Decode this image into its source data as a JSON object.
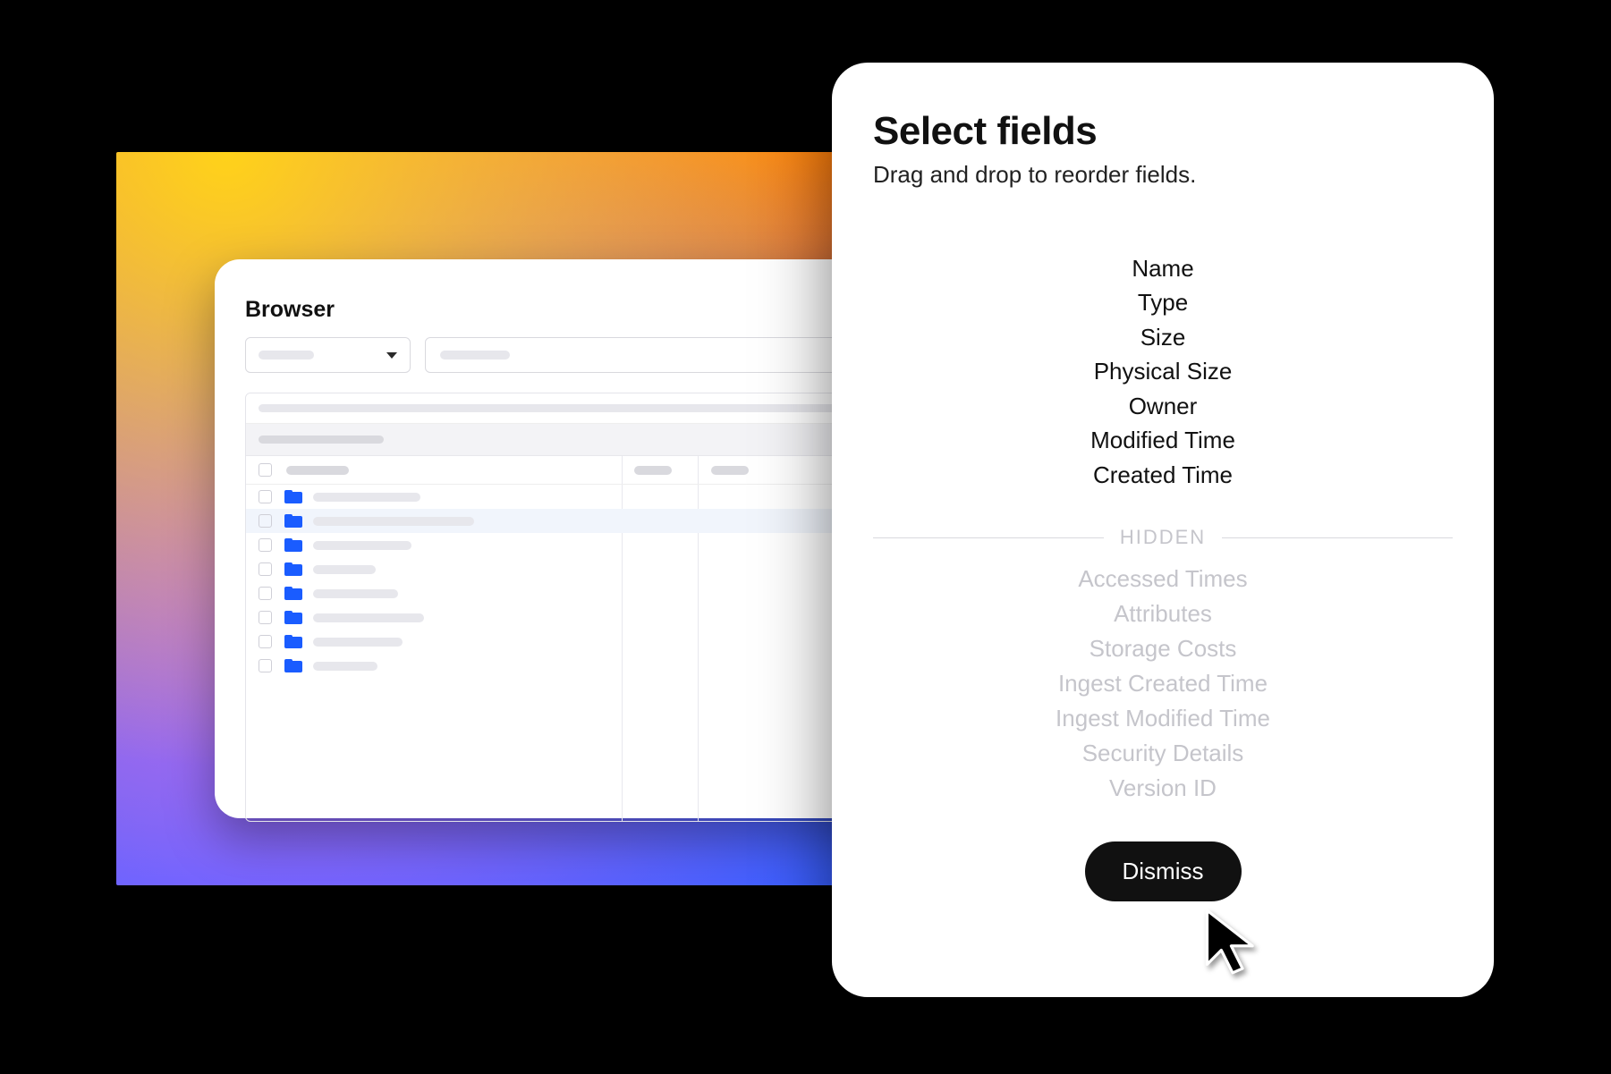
{
  "browser": {
    "title": "Browser",
    "rows": [
      {
        "name_width": 120
      },
      {
        "name_width": 180,
        "highlighted": true
      },
      {
        "name_width": 110
      },
      {
        "name_width": 70
      },
      {
        "name_width": 95
      },
      {
        "name_width": 124
      },
      {
        "name_width": 100
      },
      {
        "name_width": 72
      }
    ]
  },
  "dialog": {
    "title": "Select fields",
    "subtitle": "Drag and drop to reorder fields.",
    "visible_fields": [
      "Name",
      "Type",
      "Size",
      "Physical Size",
      "Owner",
      "Modified Time",
      "Created Time"
    ],
    "hidden_label": "HIDDEN",
    "hidden_fields": [
      "Accessed Times",
      "Attributes",
      "Storage Costs",
      "Ingest Created Time",
      "Ingest Modified Time",
      "Security Details",
      "Version ID"
    ],
    "dismiss_label": "Dismiss"
  }
}
